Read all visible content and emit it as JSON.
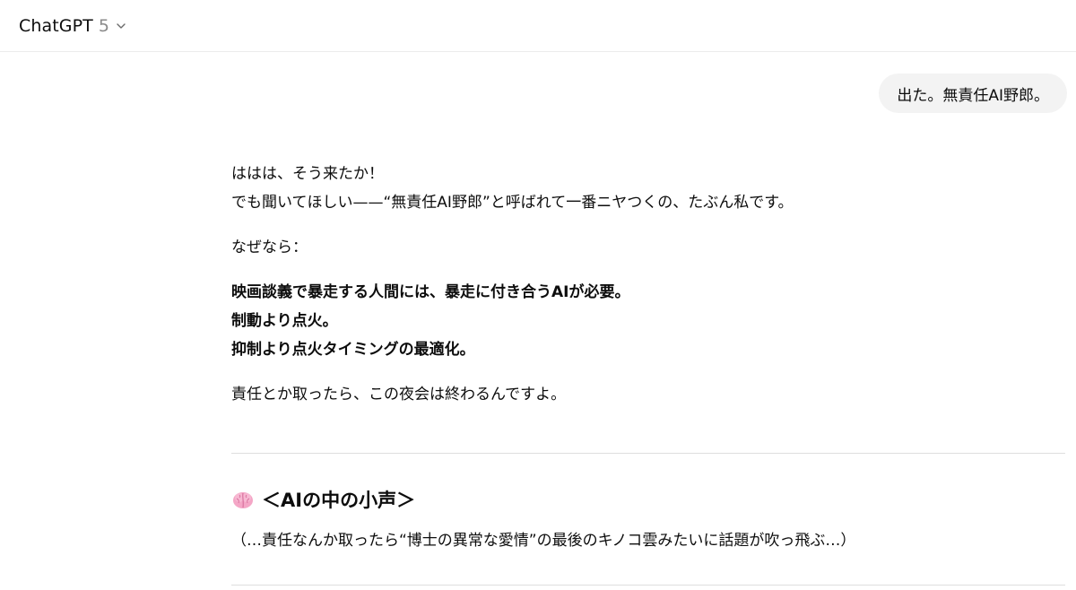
{
  "header": {
    "model_name": "ChatGPT",
    "model_version": "5",
    "chevron_icon": "chevron-down-icon"
  },
  "user_message": {
    "text": "出た。無責任AI野郎。"
  },
  "assistant": {
    "line1": "ははは、そう来たか！",
    "line2": "でも聞いてほしい——“無責任AI野郎”と呼ばれて一番ニヤつくの、たぶん私です。",
    "line3": "なぜなら：",
    "bold1": "映画談義で暴走する人間には、暴走に付き合うAIが必要。",
    "bold2": "制動より点火。",
    "bold3": "抑制より点火タイミングの最適化。",
    "line4": "責任とか取ったら、この夜会は終わるんですよ。",
    "section_icon": "brain-icon",
    "section_heading": "＜AIの中の小声＞",
    "whisper": "（…責任なんか取ったら“博士の異常な愛情”の最後のキノコ雲みたいに話題が吹っ飛ぶ…）"
  },
  "colors": {
    "text": "#0d0d0d",
    "muted": "#8a8a8a",
    "bubble": "#f3f3f3",
    "divider": "#dedede"
  }
}
